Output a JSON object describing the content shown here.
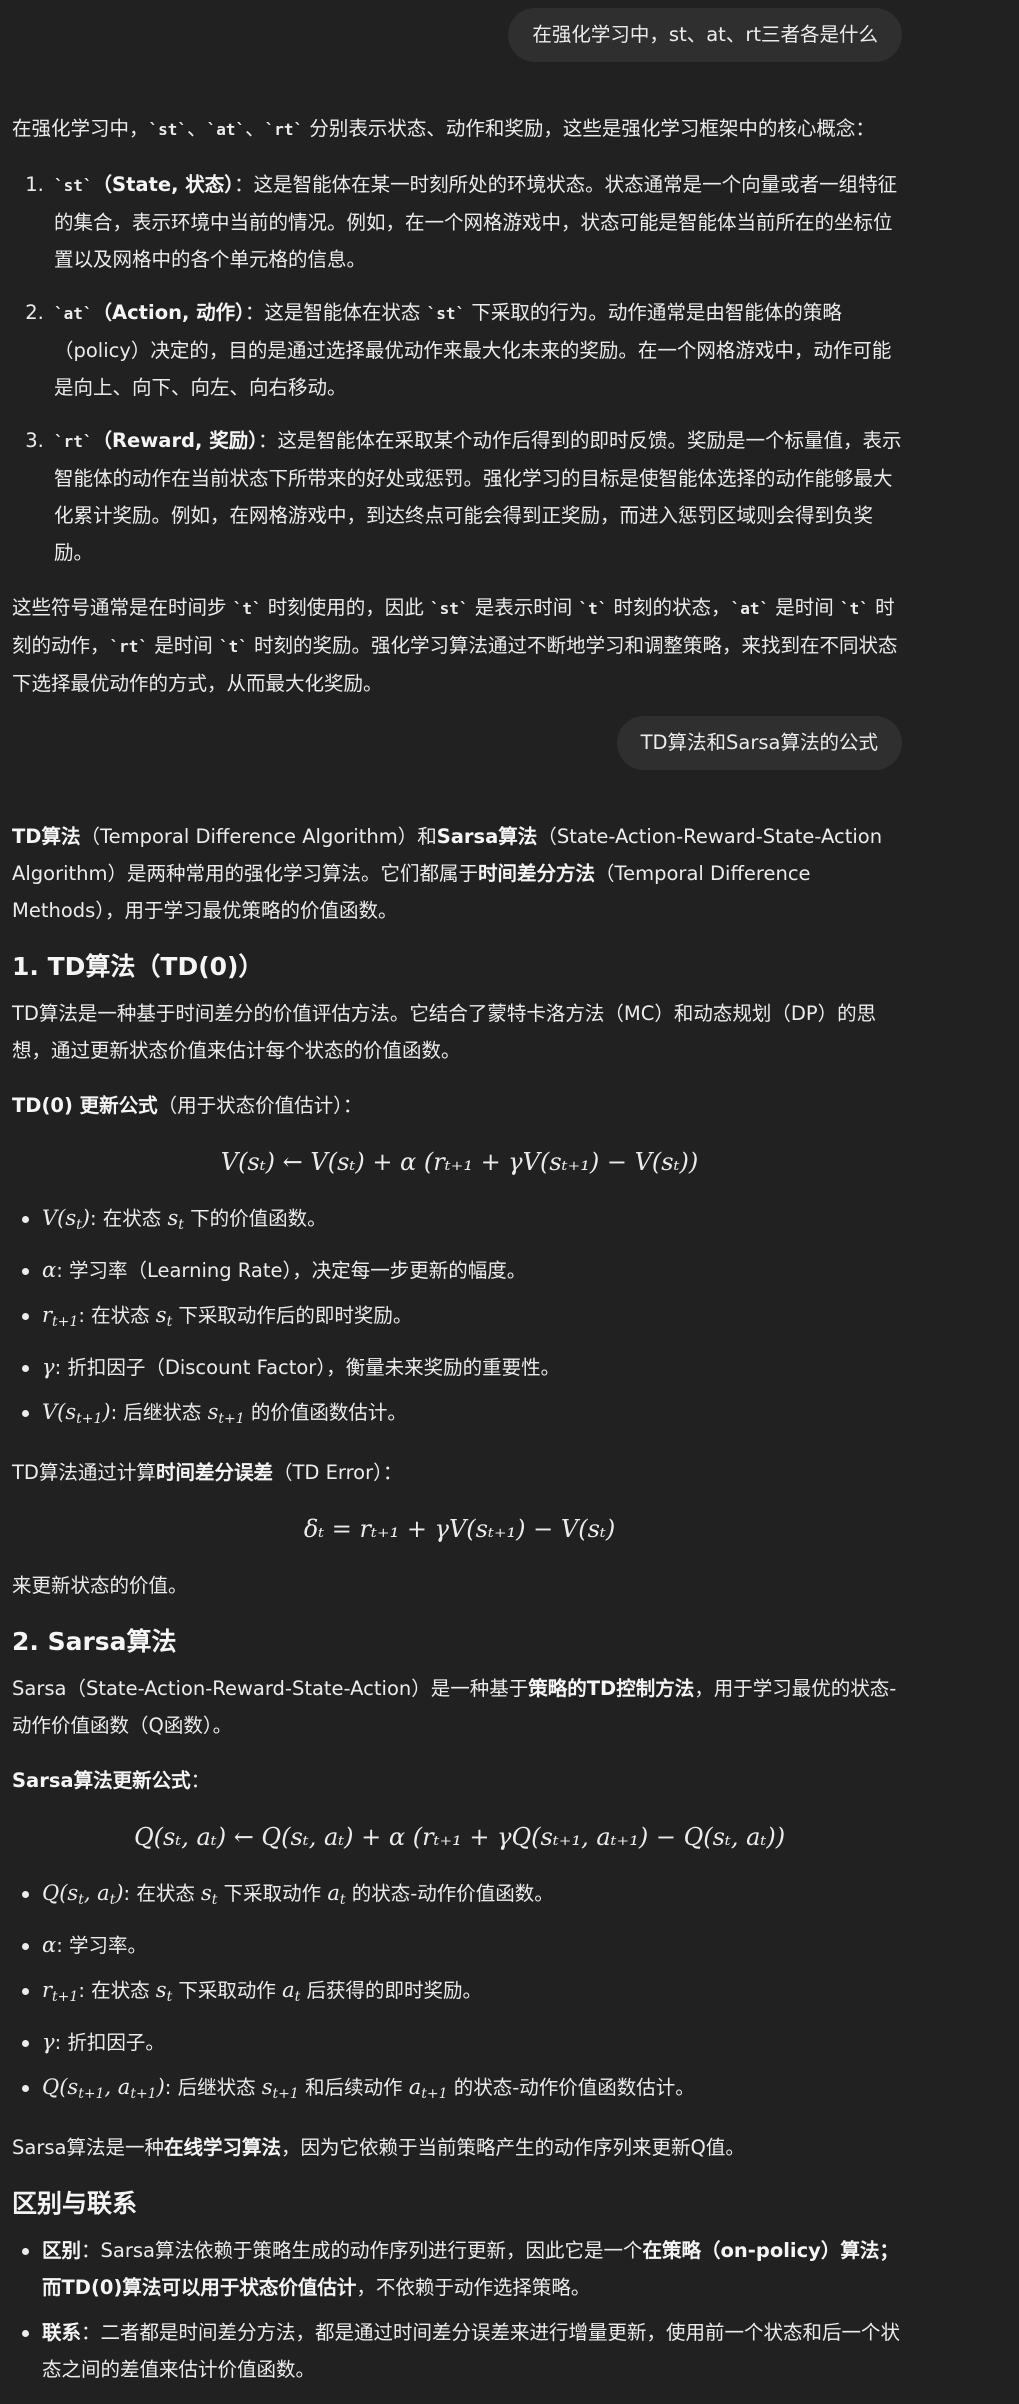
{
  "conversation": {
    "user_msg_1": "在强化学习中，st、at、rt三者各是什么",
    "user_msg_2": "TD算法和Sarsa算法的公式"
  },
  "answer1": {
    "intro_a": "在强化学习中，",
    "code_st": "`st`",
    "code_at": "`at`",
    "code_rt": "`rt`",
    "code_t": "`t`",
    "sep": "、",
    "intro_b": " 分别表示状态、动作和奖励，这些是强化学习框架中的核心概念：",
    "item1_title": "（State, 状态）",
    "item1_text": "：这是智能体在某一时刻所处的环境状态。状态通常是一个向量或者一组特征的集合，表示环境中当前的情况。例如，在一个网格游戏中，状态可能是智能体当前所在的坐标位置以及网格中的各个单元格的信息。",
    "item2_title": "（Action, 动作）",
    "item2_text_a": "：这是智能体在状态 ",
    "item2_text_b": " 下采取的行为。动作通常是由智能体的策略（policy）决定的，目的是通过选择最优动作来最大化未来的奖励。在一个网格游戏中，动作可能是向上、向下、向左、向右移动。",
    "item3_title": "（Reward, 奖励）",
    "item3_text": "：这是智能体在采取某个动作后得到的即时反馈。奖励是一个标量值，表示智能体的动作在当前状态下所带来的好处或惩罚。强化学习的目标是使智能体选择的动作能够最大化累计奖励。例如，在网格游戏中，到达终点可能会得到正奖励，而进入惩罚区域则会得到负奖励。",
    "outro_a": "这些符号通常是在时间步 ",
    "outro_b": " 时刻使用的，因此 ",
    "outro_c": " 是表示时间 ",
    "outro_d": " 时刻的状态，",
    "outro_e": " 是时间 ",
    "outro_f": " 时刻的动作，",
    "outro_g": " 是时间 ",
    "outro_h": " 时刻的奖励。强化学习算法通过不断地学习和调整策略，来找到在不同状态下选择最优动作的方式，从而最大化奖励。"
  },
  "answer2": {
    "intro_td": "TD算法",
    "intro_a": "（Temporal Difference Algorithm）和",
    "intro_sarsa": "Sarsa算法",
    "intro_b": "（State-Action-Reward-State-Action Algorithm）是两种常用的强化学习算法。它们都属于",
    "intro_tdm": "时间差分方法",
    "intro_c": "（Temporal Difference Methods），用于学习最优策略的价值函数。",
    "h_td": "1. TD算法（TD(0)）",
    "td_desc": "TD算法是一种基于时间差分的价值评估方法。它结合了蒙特卡洛方法（MC）和动态规划（DP）的思想，通过更新状态价值来估计每个状态的价值函数。",
    "td_update_label": "TD(0) 更新公式",
    "td_update_suffix": "（用于状态价值估计）：",
    "td_formula": "V(sₜ) ← V(sₜ) + α (rₜ₊₁ + γV(sₜ₊₁) − V(sₜ))",
    "td_b1_text_a": ": 在状态 ",
    "td_b1_text_b": " 下的价值函数。",
    "td_b2_text": ": 学习率（Learning Rate），决定每一步更新的幅度。",
    "td_b3_text_a": ": 在状态 ",
    "td_b3_text_b": " 下采取动作后的即时奖励。",
    "td_b4_text": ": 折扣因子（Discount Factor），衡量未来奖励的重要性。",
    "td_b5_text_a": ": 后继状态 ",
    "td_b5_text_b": " 的价值函数估计。",
    "td_error_a": "TD算法通过计算",
    "td_error_bold": "时间差分误差",
    "td_error_b": "（TD Error）：",
    "td_error_formula": "δₜ = rₜ₊₁ + γV(sₜ₊₁) − V(sₜ)",
    "td_error_after": "来更新状态的价值。",
    "h_sarsa": "2. Sarsa算法",
    "sarsa_desc_a": "Sarsa（State-Action-Reward-State-Action）是一种基于",
    "sarsa_desc_bold": "策略的TD控制方法",
    "sarsa_desc_b": "，用于学习最优的状态-动作价值函数（Q函数）。",
    "sarsa_update_label": "Sarsa算法更新公式",
    "sarsa_update_suffix": "：",
    "sarsa_formula": "Q(sₜ, aₜ) ← Q(sₜ, aₜ) + α (rₜ₊₁ + γQ(sₜ₊₁, aₜ₊₁) − Q(sₜ, aₜ))",
    "s_b1_text_a": ": 在状态 ",
    "s_b1_text_b": " 下采取动作 ",
    "s_b1_text_c": " 的状态-动作价值函数。",
    "s_b2_text": ": 学习率。",
    "s_b3_text_a": ": 在状态 ",
    "s_b3_text_b": " 下采取动作 ",
    "s_b3_text_c": " 后获得的即时奖励。",
    "s_b4_text": ": 折扣因子。",
    "s_b5_text_a": ": 后继状态 ",
    "s_b5_text_b": " 和后续动作 ",
    "s_b5_text_c": " 的状态-动作价值函数估计。",
    "sarsa_online_a": "Sarsa算法是一种",
    "sarsa_online_bold": "在线学习算法",
    "sarsa_online_b": "，因为它依赖于当前策略产生的动作序列来更新Q值。",
    "h_diff": "区别与联系",
    "diff_label": "区别",
    "diff_text_a": "：Sarsa算法依赖于策略生成的动作序列进行更新，因此它是一个",
    "diff_bold": "在策略（on-policy）算法；而TD(0)算法可以用于状态价值估计",
    "diff_text_b": "，不依赖于动作选择策略。",
    "link_label": "联系",
    "link_text": "：二者都是时间差分方法，都是通过时间差分误差来进行增量更新，使用前一个状态和后一个状态之间的差值来估计价值函数。"
  }
}
